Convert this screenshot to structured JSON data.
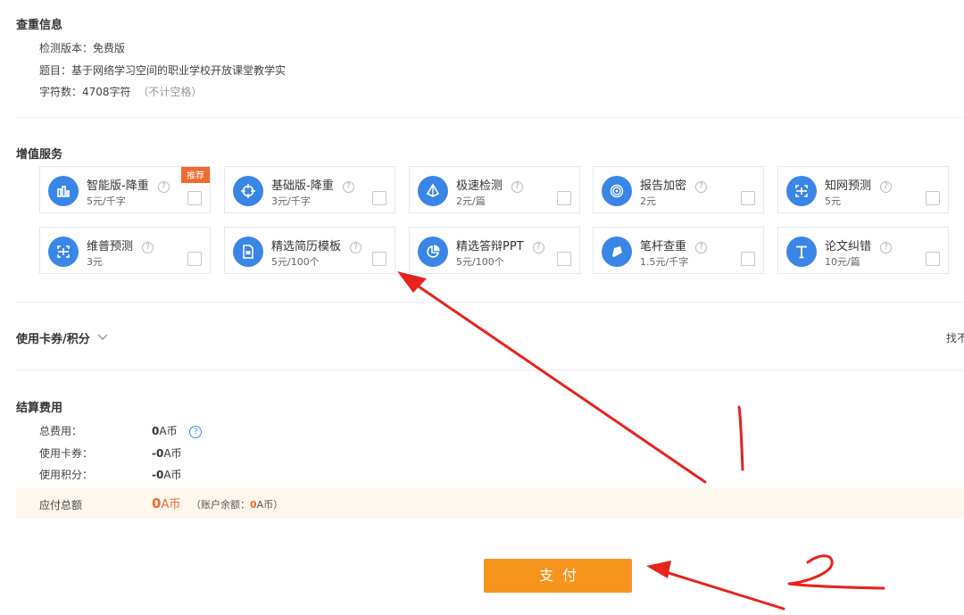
{
  "check_info": {
    "title": "查重信息",
    "version_label": "检测版本：",
    "version_value": "免费版",
    "topic_label": "题目：",
    "topic_value": "基于网络学习空间的职业学校开放课堂教学实",
    "chars_label": "字符数：",
    "chars_value": "4708字符",
    "chars_note": "（不计空格）"
  },
  "services": {
    "title": "增值服务",
    "help_glyph": "?",
    "items": [
      {
        "name": "智能版-降重",
        "price": "5元/千字",
        "tag": "推荐",
        "icon": "bar-chart-icon"
      },
      {
        "name": "基础版-降重",
        "price": "3元/千字",
        "icon": "crosshair-icon"
      },
      {
        "name": "极速检测",
        "price": "2元/篇",
        "icon": "diamond-icon"
      },
      {
        "name": "报告加密",
        "price": "2元",
        "icon": "fingerprint-icon"
      },
      {
        "name": "知网预测",
        "price": "5元",
        "icon": "scan-icon"
      },
      {
        "name": "维普预测",
        "price": "3元",
        "icon": "scan-icon"
      },
      {
        "name": "精选简历模板",
        "price": "5元/100个",
        "icon": "document-icon"
      },
      {
        "name": "精选答辩PPT",
        "price": "5元/100个",
        "icon": "pie-chart-icon"
      },
      {
        "name": "笔杆查重",
        "price": "1.5元/千字",
        "icon": "pen-nib-icon"
      },
      {
        "name": "论文纠错",
        "price": "10元/篇",
        "icon": "text-t-icon"
      }
    ]
  },
  "coupon": {
    "title": "使用卡券/积分",
    "right_text": "找不"
  },
  "settlement": {
    "title": "结算费用",
    "total_label": "总费用：",
    "total_num": "0",
    "total_unit": "A币",
    "coupon_label": "使用卡券：",
    "coupon_num": "-0",
    "coupon_unit": "A币",
    "points_label": "使用积分：",
    "points_num": "-0",
    "points_unit": "A币",
    "due_label": "应付总额",
    "due_num": "0",
    "due_unit": "A币",
    "balance_prefix": "（账户余额：",
    "balance_num": "0",
    "balance_suffix": "A币）"
  },
  "pay_button": "支付",
  "colors": {
    "accent_blue": "#3a86e6",
    "pay_orange": "#f7941d",
    "tag_orange": "#f26a2e",
    "annotation_red": "#e8231c"
  }
}
